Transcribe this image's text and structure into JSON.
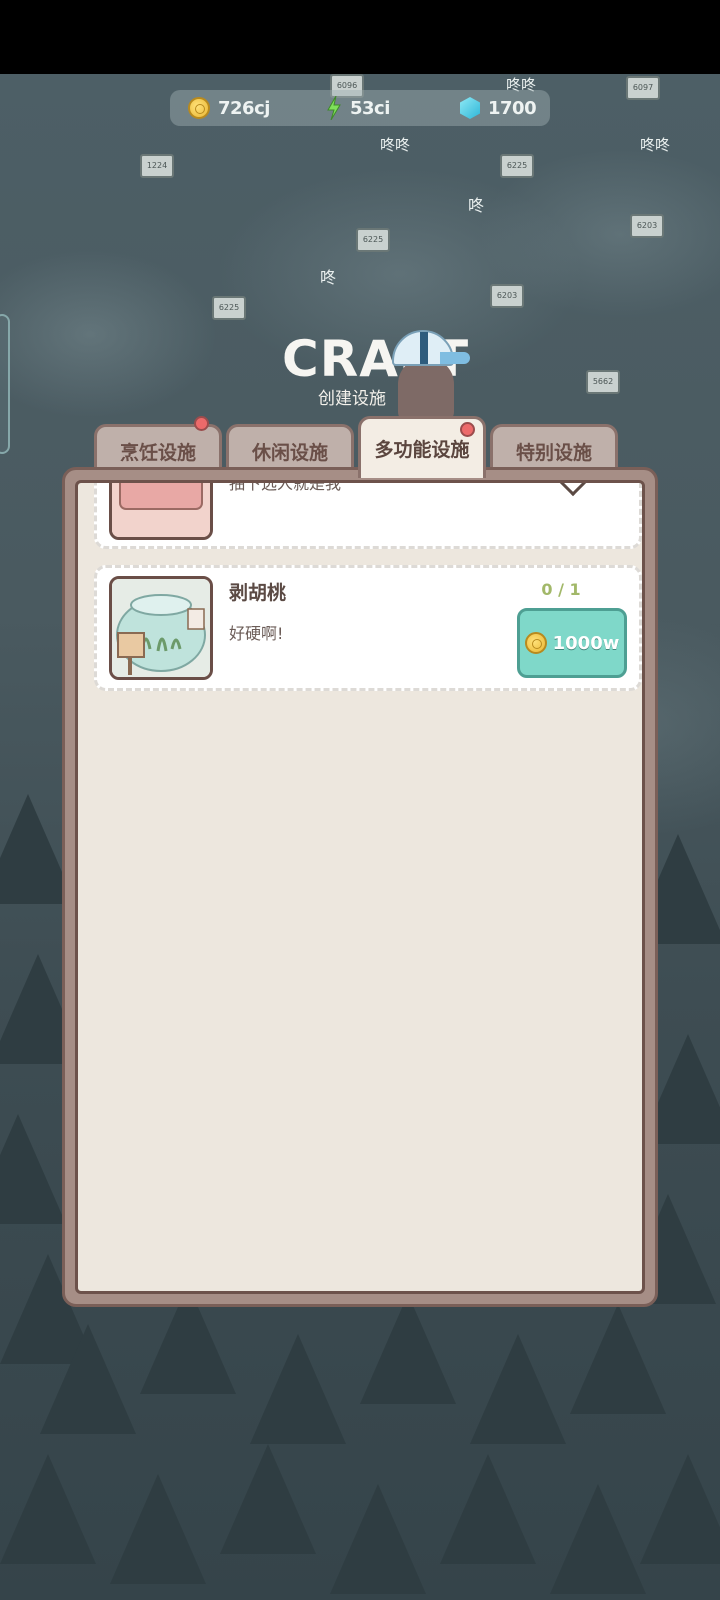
{
  "resources": {
    "coins": "726cj",
    "energy": "53ci",
    "gems": "1700"
  },
  "header": {
    "title": "CRAFT",
    "subtitle": "创建设施"
  },
  "tabs": [
    {
      "label": "烹饪设施",
      "badge": true,
      "active": false
    },
    {
      "label": "休闲设施",
      "badge": false,
      "active": false
    },
    {
      "label": "多功能设施",
      "badge": true,
      "active": true
    },
    {
      "label": "特别设施",
      "badge": false,
      "active": false
    }
  ],
  "items": [
    {
      "name": "",
      "desc": "抽下选人就是我",
      "collapsed": true
    },
    {
      "name": "剥胡桃",
      "desc": "好硬啊!",
      "count": "0 / 1",
      "price": "1000w"
    }
  ],
  "map": {
    "flags": [
      "6096",
      "1224",
      "6225",
      "6203",
      "6225",
      "6203",
      "6225",
      "5662",
      "6097"
    ],
    "bubble_texts": [
      "咚咚",
      "咚",
      "咚",
      "咚咚",
      "咚咚"
    ]
  },
  "colors": {
    "buy_button": "#7fd8c9",
    "badge": "#ec6a6a",
    "count": "#a2b869"
  },
  "icons": [
    "coin-icon",
    "energy-icon",
    "gem-icon",
    "chevron-down-icon"
  ]
}
